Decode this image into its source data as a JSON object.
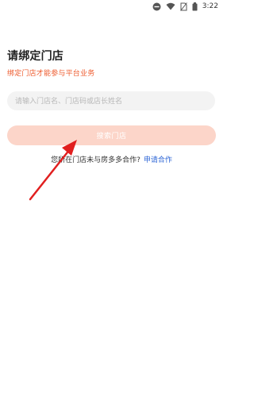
{
  "status_bar": {
    "time": "3:22",
    "icons": [
      "dnd-icon",
      "wifi-icon",
      "no-sim-icon",
      "battery-icon"
    ]
  },
  "page": {
    "title": "请绑定门店",
    "subtitle": "绑定门店才能参与平台业务"
  },
  "search": {
    "placeholder": "请输入门店名、门店码或店长姓名",
    "value": ""
  },
  "search_button": {
    "label": "搜索门店"
  },
  "cooperation": {
    "question": "您所在门店未与房多多合作?",
    "link_label": "申请合作"
  },
  "colors": {
    "accent": "#ee5b2e",
    "button_bg": "#fcd5c9",
    "link": "#2f67d6",
    "annotation_arrow": "#e11f1f"
  }
}
